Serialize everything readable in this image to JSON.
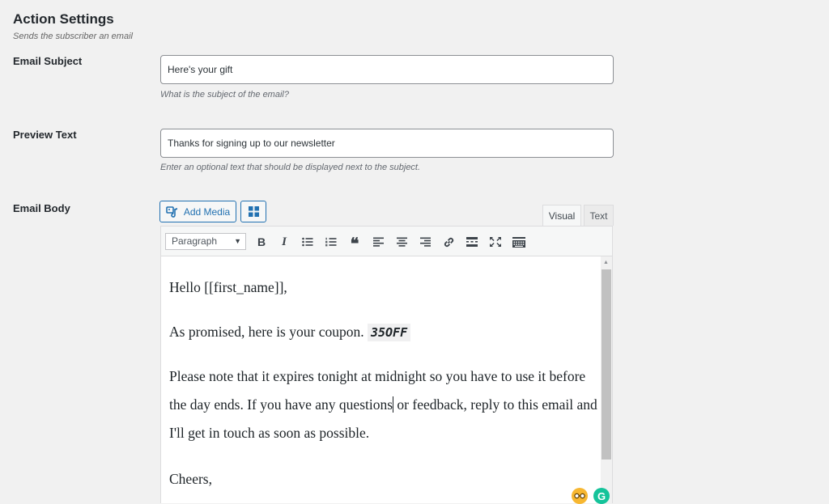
{
  "section": {
    "title": "Action Settings",
    "description": "Sends the subscriber an email"
  },
  "subject": {
    "label": "Email Subject",
    "value": "Here's your gift",
    "description": "What is the subject of the email?"
  },
  "preview": {
    "label": "Preview Text",
    "value": "Thanks for signing up to our newsletter",
    "description": "Enter an optional text that should be displayed next to the subject."
  },
  "body": {
    "label": "Email Body",
    "add_media_label": "Add Media",
    "tabs": {
      "visual": "Visual",
      "text": "Text"
    },
    "format_select": "Paragraph",
    "toolbar_icons": [
      "bold-icon",
      "italic-icon",
      "bullet-list-icon",
      "numbered-list-icon",
      "blockquote-icon",
      "align-left-icon",
      "align-center-icon",
      "align-right-icon",
      "link-icon",
      "read-more-icon",
      "fullscreen-icon",
      "toolbar-toggle-icon"
    ],
    "content": {
      "greeting": "Hello [[first_name]],",
      "coupon_intro": "As promised, here is your coupon.",
      "coupon_code": "35OFF",
      "paragraph_before_cursor": "Please note that it expires tonight at midnight so you have to use it before the day ends. If you have any questions",
      "paragraph_after_cursor": " or feedback, reply to this email and I'll get in touch as soon as possible.",
      "signoff": "Cheers,"
    }
  },
  "colors": {
    "accent": "#2271b1",
    "background": "#f1f1f1",
    "grammarly": "#15c39a"
  }
}
